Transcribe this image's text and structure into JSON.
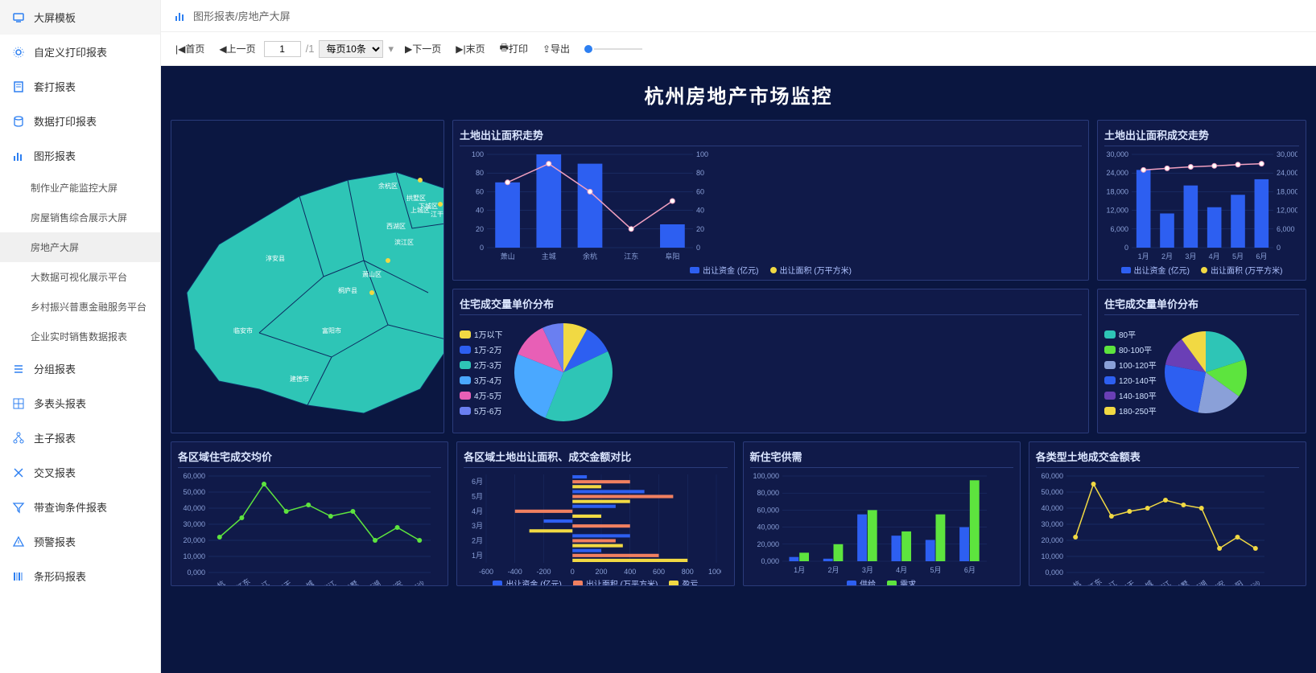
{
  "sidebar": {
    "items": [
      {
        "label": "大屏模板",
        "icon": "monitor"
      },
      {
        "label": "自定义打印报表",
        "icon": "gear"
      },
      {
        "label": "套打报表",
        "icon": "doc"
      },
      {
        "label": "数据打印报表",
        "icon": "db"
      },
      {
        "label": "图形报表",
        "icon": "chart",
        "children": [
          "制作业产能监控大屏",
          "房屋销售综合展示大屏",
          "房地产大屏",
          "大数据可视化展示平台",
          "乡村振兴普惠金融服务平台",
          "企业实时销售数据报表"
        ]
      },
      {
        "label": "分组报表",
        "icon": "list"
      },
      {
        "label": "多表头报表",
        "icon": "grid"
      },
      {
        "label": "主子报表",
        "icon": "tree"
      },
      {
        "label": "交叉报表",
        "icon": "cross"
      },
      {
        "label": "带查询条件报表",
        "icon": "filter"
      },
      {
        "label": "预警报表",
        "icon": "warn"
      },
      {
        "label": "条形码报表",
        "icon": "barcode"
      }
    ],
    "active_child": "房地产大屏"
  },
  "breadcrumb": {
    "text": "图形报表/房地产大屏"
  },
  "toolbar": {
    "first": "首页",
    "prev": "上一页",
    "page_value": "1",
    "total": "/1",
    "pagesize": "每页10条",
    "next": "下一页",
    "last": "末页",
    "print": "打印",
    "export": "导出"
  },
  "dashboard": {
    "title": "杭州房地产市场监控",
    "panels": {
      "land_area": {
        "title": "土地出让面积走势"
      },
      "land_trend": {
        "title": "土地出让面积成交走势"
      },
      "price_dist": {
        "title": "住宅成交量单价分布"
      },
      "area_dist": {
        "title": "住宅成交量单价分布"
      },
      "avg_price": {
        "title": "各区域住宅成交均价"
      },
      "land_compare": {
        "title": "各区域土地出让面积、成交金额对比"
      },
      "supply": {
        "title": "新住宅供需"
      },
      "type_amount": {
        "title": "各类型土地成交金额表"
      }
    },
    "legends": {
      "bar_line": [
        "出让资金 (亿元)",
        "出让面积 (万平方米)"
      ],
      "compare": [
        "出让资金 (亿元)",
        "出让面积 (万平方米)",
        "盈亏"
      ],
      "supply": [
        "供给",
        "需求"
      ],
      "price_ranges": [
        "1万以下",
        "1万-2万",
        "2万-3万",
        "3万-4万",
        "4万-5万",
        "5万-6万"
      ],
      "area_ranges": [
        "80平",
        "80-100平",
        "100-120平",
        "120-140平",
        "140-180平",
        "180-250平"
      ]
    },
    "map_labels": [
      "余杭区",
      "拱墅区",
      "西湖区",
      "下城区",
      "江干区",
      "上城区",
      "滨江区",
      "萧山区",
      "富阳市",
      "临安市",
      "建德市",
      "桐庐县",
      "淳安县"
    ]
  },
  "chart_data": [
    {
      "id": "land_area",
      "type": "bar-line",
      "categories": [
        "萧山",
        "主城",
        "余杭",
        "江东",
        "阜阳"
      ],
      "bars": [
        70,
        100,
        90,
        0,
        25
      ],
      "line": [
        70,
        90,
        60,
        20,
        50
      ],
      "yleft": [
        0,
        100
      ],
      "yright": [
        0,
        100
      ],
      "bar_label": "出让资金 (亿元)",
      "line_label": "出让面积 (万平方米)"
    },
    {
      "id": "land_trend",
      "type": "bar-line",
      "categories": [
        "1月",
        "2月",
        "3月",
        "4月",
        "5月",
        "6月"
      ],
      "bars": [
        25000,
        11000,
        20000,
        13000,
        17000,
        22000
      ],
      "line": [
        25000,
        25500,
        26000,
        26300,
        26700,
        27000
      ],
      "yleft": [
        0,
        30000
      ],
      "yright": [
        0,
        30000
      ]
    },
    {
      "id": "price_dist",
      "type": "pie",
      "series": [
        {
          "name": "1万以下",
          "value": 8,
          "color": "#f1d943"
        },
        {
          "name": "1万-2万",
          "value": 10,
          "color": "#2d5ff1"
        },
        {
          "name": "2万-3万",
          "value": 38,
          "color": "#2ec5b6"
        },
        {
          "name": "3万-4万",
          "value": 25,
          "color": "#4aa8ff"
        },
        {
          "name": "4万-5万",
          "value": 12,
          "color": "#e85fb6"
        },
        {
          "name": "5万-6万",
          "value": 7,
          "color": "#6a7ff1"
        }
      ]
    },
    {
      "id": "area_dist",
      "type": "pie",
      "series": [
        {
          "name": "80平",
          "value": 20,
          "color": "#2ec5b6"
        },
        {
          "name": "80-100平",
          "value": 15,
          "color": "#5de43e"
        },
        {
          "name": "100-120平",
          "value": 18,
          "color": "#8aa0d8"
        },
        {
          "name": "120-140平",
          "value": 25,
          "color": "#2d5ff1"
        },
        {
          "name": "140-180平",
          "value": 12,
          "color": "#6a3fb6"
        },
        {
          "name": "180-250平",
          "value": 10,
          "color": "#f1d943"
        }
      ]
    },
    {
      "id": "avg_price",
      "type": "line",
      "x": [
        "余杭",
        "大江东",
        "之江",
        "江干",
        "上城",
        "滨江",
        "拱墅",
        "西湖",
        "临安",
        "下沙"
      ],
      "y": [
        22000,
        34000,
        55000,
        38000,
        42000,
        35000,
        38000,
        20000,
        28000,
        20000
      ],
      "ylim": [
        0,
        60000
      ]
    },
    {
      "id": "land_compare",
      "type": "bar-h",
      "categories": [
        "1月",
        "2月",
        "3月",
        "4月",
        "5月",
        "6月"
      ],
      "series": [
        {
          "name": "出让资金 (亿元)",
          "color": "#2d5ff1",
          "values": [
            200,
            400,
            -200,
            300,
            500,
            100
          ]
        },
        {
          "name": "出让面积 (万平方米)",
          "color": "#f18060",
          "values": [
            600,
            300,
            400,
            -400,
            700,
            400
          ]
        },
        {
          "name": "盈亏",
          "color": "#f1d943",
          "values": [
            800,
            350,
            -300,
            200,
            400,
            200
          ]
        }
      ],
      "xlim": [
        -600,
        1000
      ]
    },
    {
      "id": "supply",
      "type": "bar-grouped",
      "categories": [
        "1月",
        "2月",
        "3月",
        "4月",
        "5月",
        "6月"
      ],
      "series": [
        {
          "name": "供给",
          "color": "#2d5ff1",
          "values": [
            5000,
            3000,
            55000,
            30000,
            25000,
            40000
          ]
        },
        {
          "name": "需求",
          "color": "#5de43e",
          "values": [
            10000,
            20000,
            60000,
            35000,
            55000,
            95000
          ]
        }
      ],
      "ylim": [
        0,
        100000
      ]
    },
    {
      "id": "type_amount",
      "type": "line",
      "x": [
        "余杭",
        "大江东",
        "之江",
        "江干",
        "上城",
        "滨江",
        "拱墅",
        "西湖",
        "临安",
        "阜阳",
        "下沙"
      ],
      "y": [
        22000,
        55000,
        35000,
        38000,
        40000,
        45000,
        42000,
        40000,
        15000,
        22000,
        15000
      ],
      "ylim": [
        0,
        60000
      ]
    }
  ]
}
